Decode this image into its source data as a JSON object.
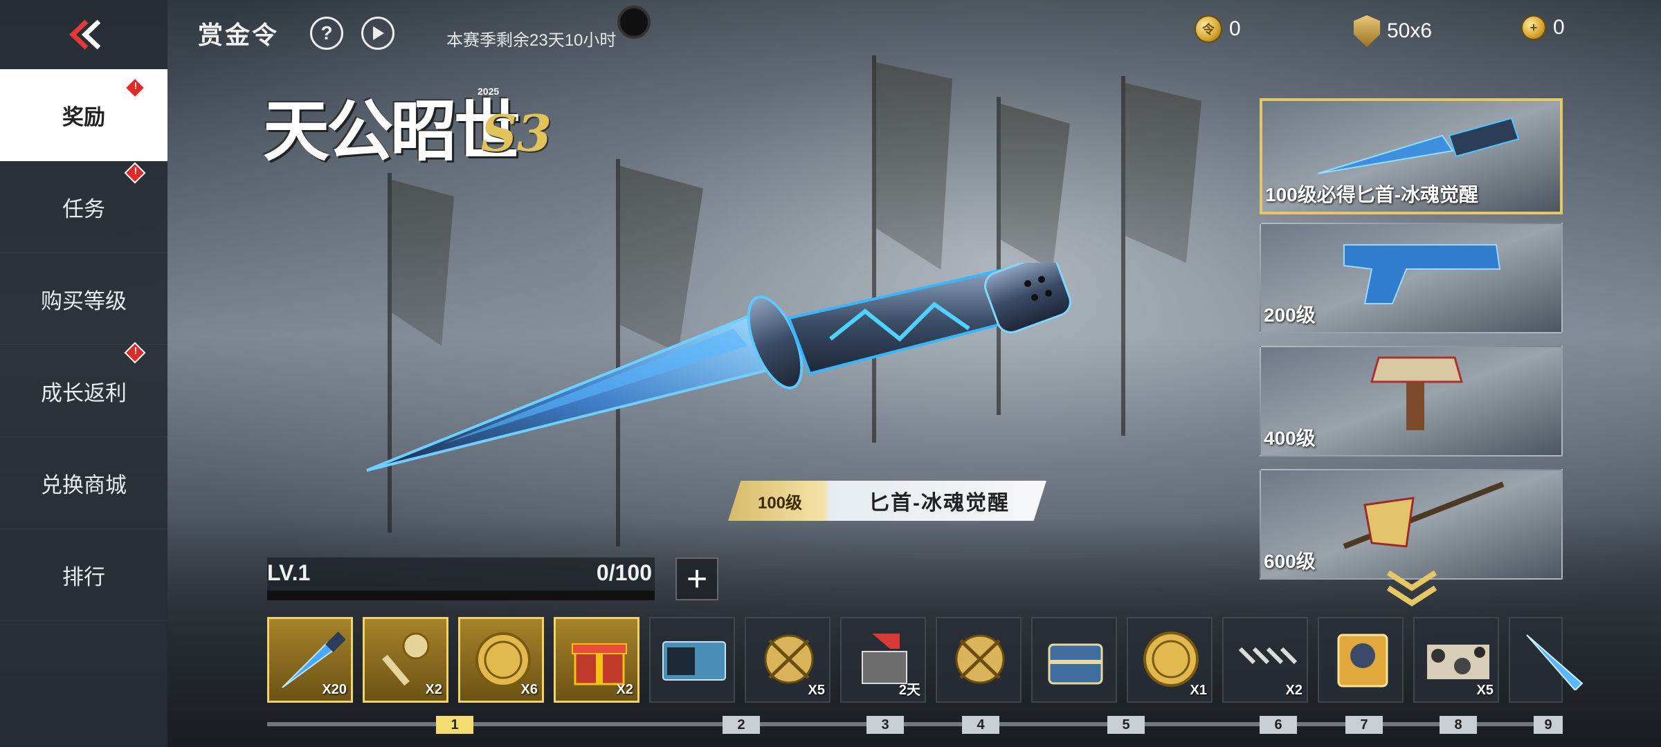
{
  "header": {
    "title": "赏金令",
    "help_icon": "?",
    "season_remaining": "本赛季剩余23天10小时"
  },
  "currencies": [
    {
      "icon": "gold-coin-icon",
      "value": "0"
    },
    {
      "icon": "shield-token-icon",
      "value": "50x6"
    },
    {
      "icon": "bounty-coin-add-icon",
      "value": "0"
    }
  ],
  "sidebar": {
    "items": [
      {
        "label": "奖励",
        "active": true,
        "badge": true
      },
      {
        "label": "任务",
        "active": false,
        "badge": true
      },
      {
        "label": "购买等级",
        "active": false,
        "badge": false
      },
      {
        "label": "成长返利",
        "active": false,
        "badge": true
      },
      {
        "label": "兑换商城",
        "active": false,
        "badge": false
      },
      {
        "label": "排行",
        "active": false,
        "badge": false
      }
    ]
  },
  "logo": {
    "text": "天公昭世",
    "season": "S3",
    "year": "2025"
  },
  "featured": {
    "level": "100级",
    "name": "匕首-冰魂觉醒"
  },
  "progress": {
    "level_label": "LV.1",
    "progress_text": "0/100",
    "fraction": 0.0,
    "add_label": "+"
  },
  "reward_cards": [
    {
      "label": "100级必得匕首-冰魂觉醒",
      "selected": true
    },
    {
      "label": "200级",
      "selected": false
    },
    {
      "label": "400级",
      "selected": false
    },
    {
      "label": "600级",
      "selected": false
    }
  ],
  "reward_strip": [
    {
      "type": "dagger",
      "count": "X20",
      "gold": true
    },
    {
      "type": "key",
      "count": "X2",
      "gold": true
    },
    {
      "type": "coin",
      "count": "X6",
      "gold": true
    },
    {
      "type": "giftbox",
      "count": "X2",
      "gold": true
    },
    {
      "type": "card",
      "count": "",
      "gold": false
    },
    {
      "type": "crossed-coin",
      "count": "X5",
      "gold": false
    },
    {
      "type": "crate-arrow",
      "count": "2天",
      "gold": false
    },
    {
      "type": "crossed-coin",
      "count": "",
      "gold": false
    },
    {
      "type": "chest",
      "count": "",
      "gold": false
    },
    {
      "type": "coin",
      "count": "X1",
      "gold": false
    },
    {
      "type": "chain",
      "count": "X2",
      "gold": false
    },
    {
      "type": "portrait-card",
      "count": "",
      "gold": false
    },
    {
      "type": "camo",
      "count": "X5",
      "gold": false
    },
    {
      "type": "blade",
      "count": "",
      "gold": false
    }
  ],
  "level_markers": [
    "1",
    "2",
    "3",
    "4",
    "5",
    "6",
    "7",
    "8",
    "9"
  ],
  "colors": {
    "gold": "#e6c766",
    "sidebar": "#262c34",
    "badge": "#e02a2a",
    "accent_blue": "#2fa8ff"
  }
}
